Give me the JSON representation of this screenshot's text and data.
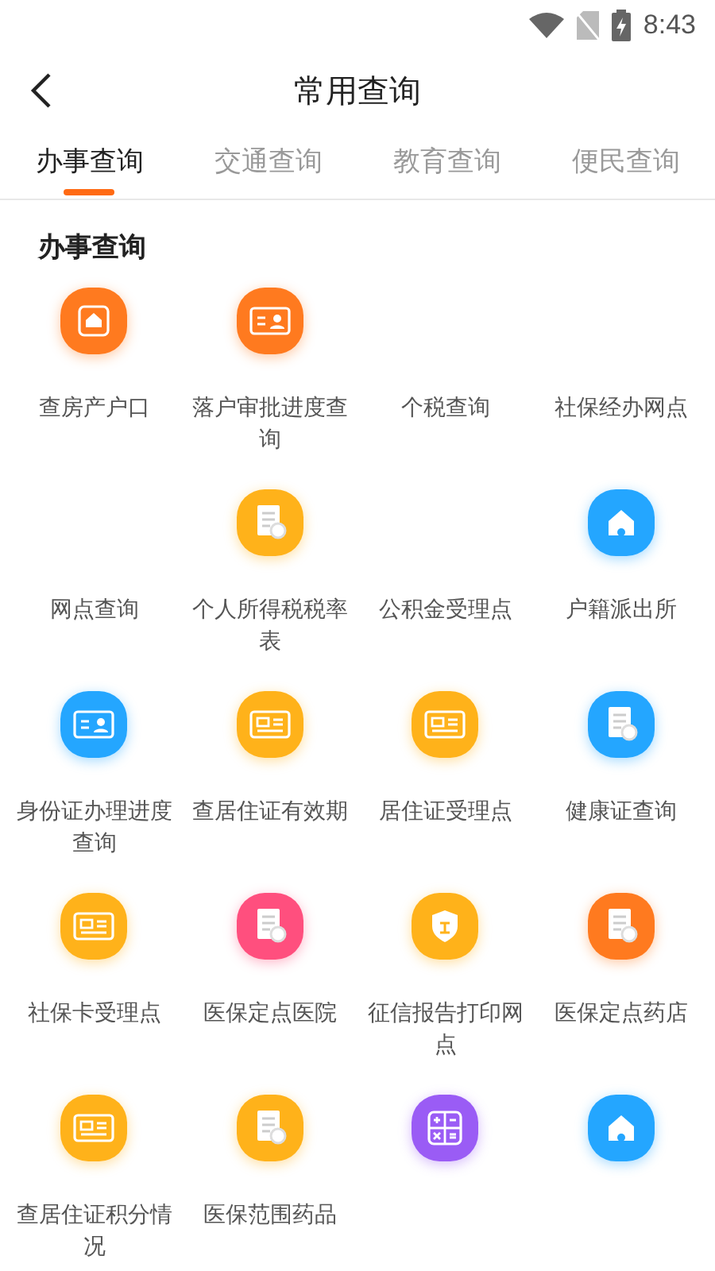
{
  "status_bar": {
    "time": "8:43"
  },
  "header": {
    "title": "常用查询"
  },
  "tabs": [
    {
      "label": "办事查询",
      "selected": true
    },
    {
      "label": "交通查询",
      "selected": false
    },
    {
      "label": "教育查询",
      "selected": false
    },
    {
      "label": "便民查询",
      "selected": false
    }
  ],
  "section": {
    "title": "办事查询",
    "items": [
      {
        "label": "查房产户口",
        "kind": "house",
        "color": "#ff7a1f"
      },
      {
        "label": "落户审批进度查询",
        "kind": "person",
        "color": "#ff7a1f"
      },
      {
        "label": "个税查询"
      },
      {
        "label": "社保经办网点"
      },
      {
        "label": "网点查询"
      },
      {
        "label": "个人所得税税率表",
        "kind": "document",
        "color": "#ffb21a"
      },
      {
        "label": "公积金受理点"
      },
      {
        "label": "户籍派出所",
        "kind": "station",
        "color": "#24a6ff"
      },
      {
        "label": "身份证办理进度查询",
        "kind": "person",
        "color": "#24a6ff"
      },
      {
        "label": "查居住证有效期",
        "kind": "card",
        "color": "#ffb21a"
      },
      {
        "label": "居住证受理点",
        "kind": "card",
        "color": "#ffb21a"
      },
      {
        "label": "健康证查询",
        "kind": "document",
        "color": "#24a6ff"
      },
      {
        "label": "社保卡受理点",
        "kind": "card",
        "color": "#ffb21a"
      },
      {
        "label": "医保定点医院",
        "kind": "document",
        "color": "#ff4f7e"
      },
      {
        "label": "征信报告打印网点",
        "kind": "shield",
        "color": "#ffb21a"
      },
      {
        "label": "医保定点药店",
        "kind": "document",
        "color": "#ff7a1f"
      },
      {
        "label": "查居住证积分情况",
        "kind": "card",
        "color": "#ffb21a"
      },
      {
        "label": "医保范围药品",
        "kind": "document",
        "color": "#ffb21a"
      },
      {
        "kind": "calculator",
        "color": "#9a5cf5"
      },
      {
        "kind": "station",
        "color": "#24a6ff"
      }
    ]
  }
}
